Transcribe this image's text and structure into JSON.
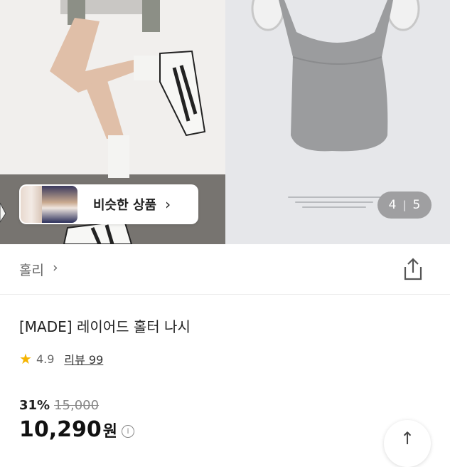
{
  "gallery": {
    "similar_label": "비슷한 상품",
    "similar_chevron": "›",
    "counter_current": "4",
    "counter_sep": "|",
    "counter_total": "5"
  },
  "store": {
    "name": "홀리",
    "chevron": "›",
    "share_icon": "share-icon"
  },
  "product": {
    "title": "[MADE] 레이어드 홀터 나시",
    "rating": "4.9",
    "review_label": "리뷰 99",
    "discount": "31%",
    "original_price": "15,000",
    "price": "10,290",
    "currency": "원",
    "info_icon": "i"
  },
  "colors": {
    "star": "#f5b400",
    "counter_bg": "#646464"
  },
  "scroll_top_icon": "↑"
}
